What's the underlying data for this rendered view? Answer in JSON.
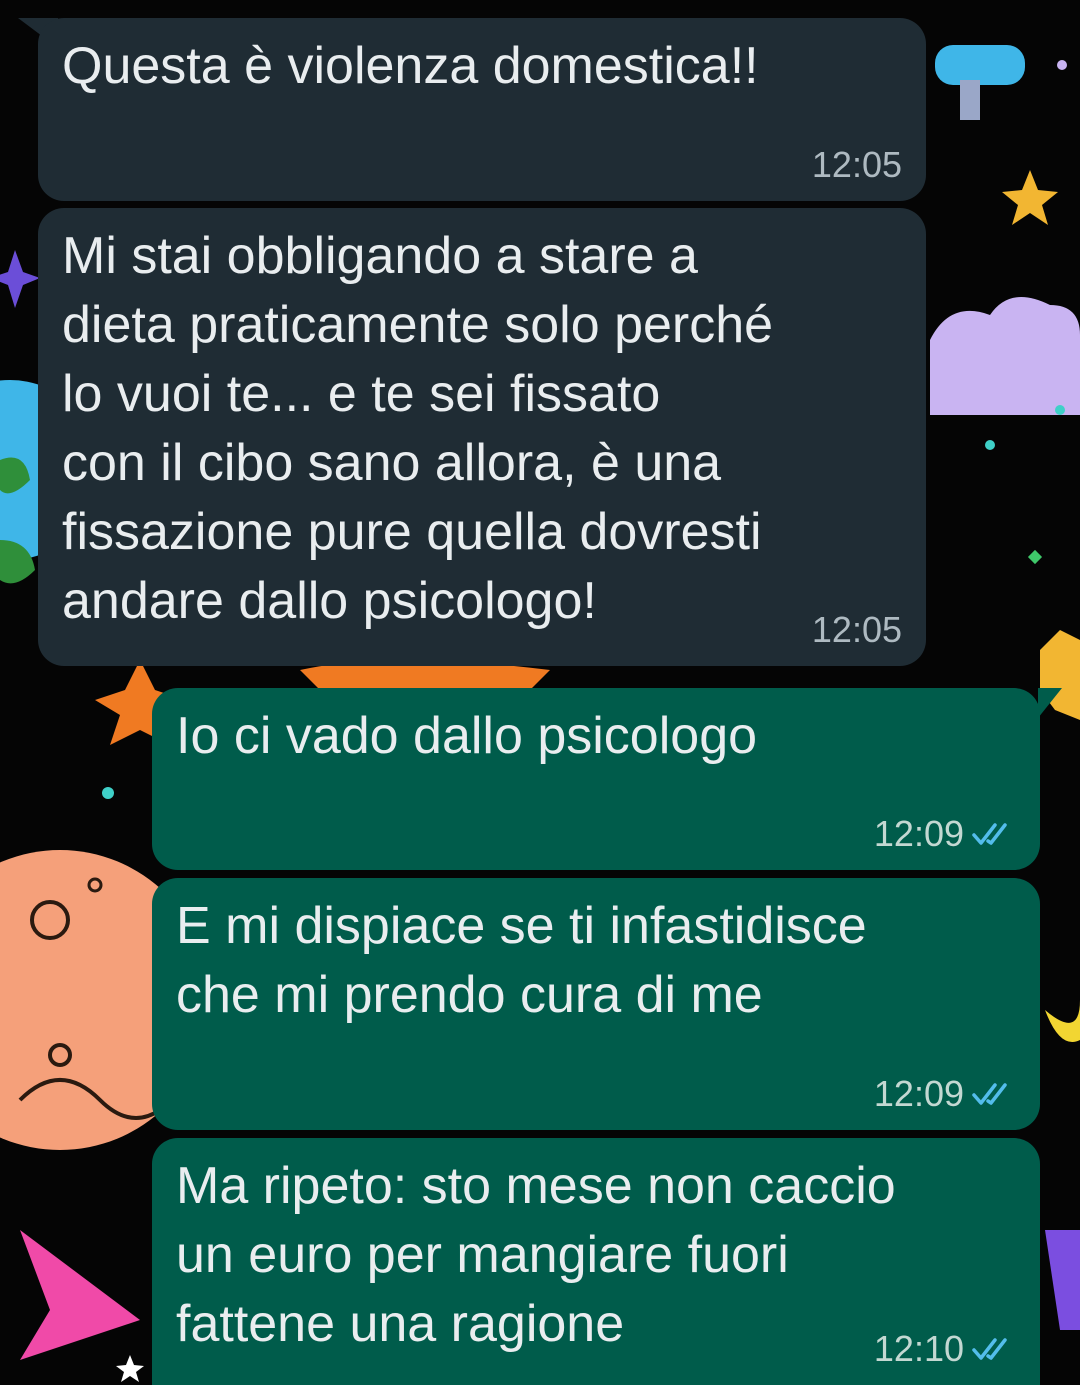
{
  "chat": {
    "messages": [
      {
        "direction": "incoming",
        "text": "Questa è violenza domestica!!",
        "time": "12:05",
        "read_status": ""
      },
      {
        "direction": "incoming",
        "text": "Mi stai obbligando a stare a\ndieta praticamente solo perché\nlo vuoi te... e te sei fissato\ncon il cibo sano allora, è una\nfissazione pure quella dovresti\nandare dallo psicologo!",
        "time": "12:05",
        "read_status": ""
      },
      {
        "direction": "outgoing",
        "text": "Io ci vado dallo psicologo",
        "time": "12:09",
        "read_status": "read"
      },
      {
        "direction": "outgoing",
        "text": "E mi dispiace se ti infastidisce\nche mi prendo cura di me",
        "time": "12:09",
        "read_status": "read"
      },
      {
        "direction": "outgoing",
        "text": "Ma ripeto: sto mese non caccio\nun euro per mangiare fuori\nfattene una ragione",
        "time": "12:10",
        "read_status": "read"
      }
    ]
  },
  "colors": {
    "incoming_bubble": "#1f2c34",
    "outgoing_bubble": "#005c4b",
    "read_ticks": "#53bdeb",
    "wallpaper_bg": "#050505"
  },
  "icons": {
    "read_receipt": "double-check-icon"
  }
}
